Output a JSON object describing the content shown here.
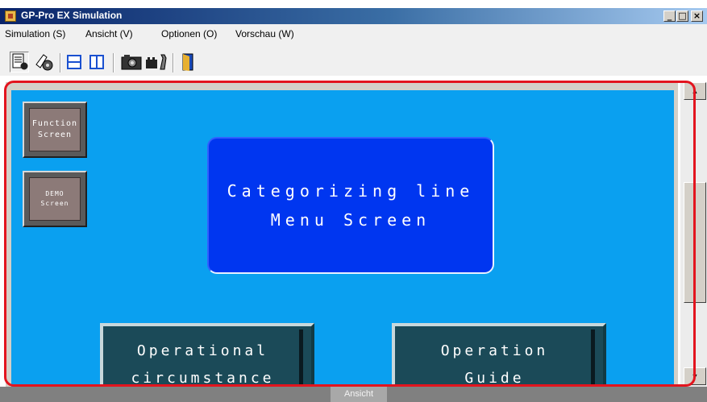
{
  "window": {
    "title": "GP-Pro EX Simulation",
    "controls": [
      "_",
      "□",
      "×"
    ]
  },
  "menubar": {
    "items": [
      "Simulation (S)",
      "Ansicht (V)",
      "Optionen (O)",
      "Vorschau (W)"
    ]
  },
  "toolbar": {
    "icons": [
      "document-edit-icon",
      "settings-icon",
      "split-horizontal-icon",
      "split-vertical-icon",
      "camera-icon",
      "tool-icon",
      "exit-icon"
    ]
  },
  "screen": {
    "background": "#0aa0f0",
    "function_button": {
      "line1": "Function",
      "line2": "Screen"
    },
    "demo_button": {
      "line1": "DEMO",
      "line2": "Screen"
    },
    "menu_panel": {
      "line1": "Categorizing line",
      "line2": "Menu Screen"
    },
    "operational_button": {
      "line1": "Operational",
      "line2": "circumstance"
    },
    "guide_button": {
      "line1": "Operation",
      "line2": "Guide"
    }
  },
  "status": {
    "label": "Ansicht"
  },
  "colors": {
    "highlight": "#e3141e",
    "panel": "#0036f0",
    "op_button": "#1b4a58"
  }
}
